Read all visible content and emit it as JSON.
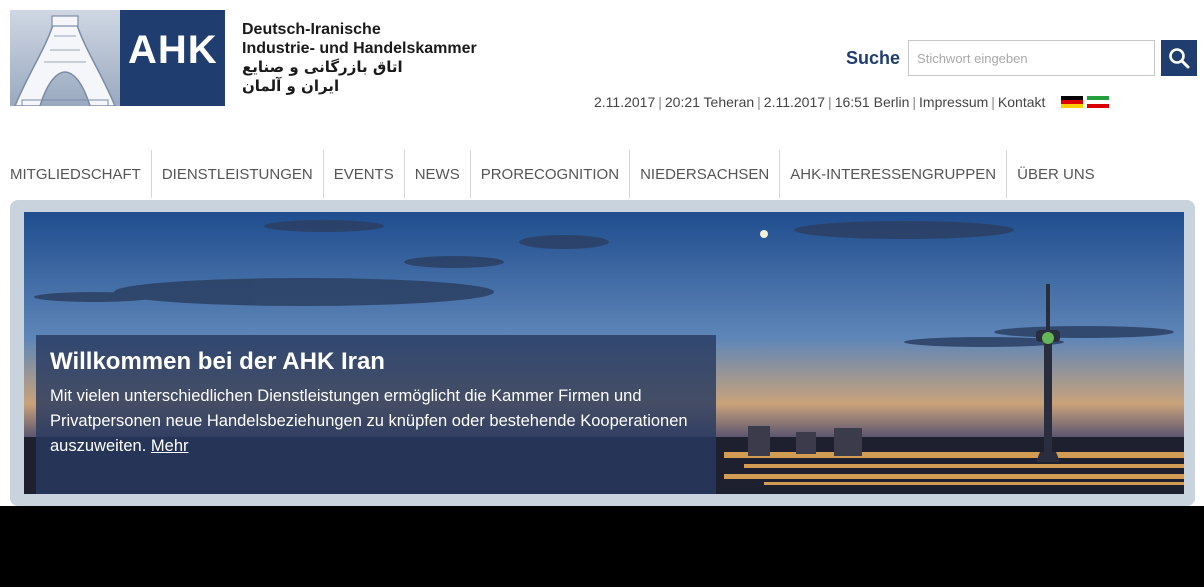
{
  "brand": {
    "logo_text": "AHK",
    "name_line1": "Deutsch-Iranische",
    "name_line2": "Industrie- und Handelskammer",
    "name_fa_line1": "اتاق بازرگانی و صنایع",
    "name_fa_line2": "ایران و آلمان",
    "color": "#1f3d6e"
  },
  "search": {
    "label": "Suche",
    "placeholder": "Stichwort eingeben",
    "button_icon": "magnifier-icon"
  },
  "topbar": {
    "date_tehran": "2.11.2017",
    "time_tehran": "20:21 Teheran",
    "date_berlin": "2.11.2017",
    "time_berlin": "16:51 Berlin",
    "impressum": "Impressum",
    "kontakt": "Kontakt",
    "flags": [
      "german-flag-icon",
      "iranian-flag-icon"
    ]
  },
  "nav": {
    "items": [
      "MITGLIEDSCHAFT",
      "DIENSTLEISTUNGEN",
      "EVENTS",
      "NEWS",
      "PRORECOGNITION",
      "NIEDERSACHSEN",
      "AHK-INTERESSENGRUPPEN",
      "ÜBER UNS"
    ]
  },
  "hero": {
    "title": "Willkommen bei der AHK Iran",
    "text": "Mit vielen unterschiedlichen Dienstleistungen ermöglicht die Kammer Firmen und Privatpersonen neue Handelsbeziehungen zu knüpfen oder bestehende Kooperationen auszuweiten.",
    "link": "Mehr"
  }
}
